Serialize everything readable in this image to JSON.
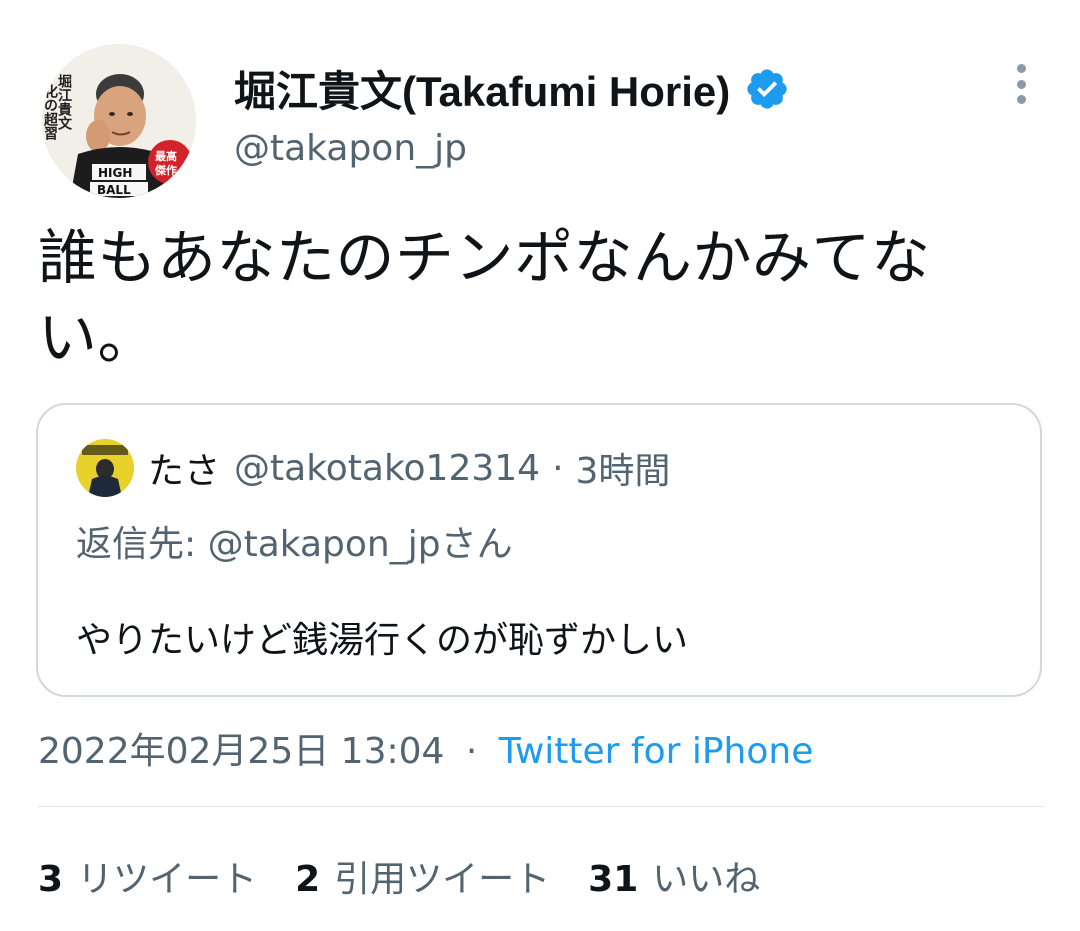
{
  "author": {
    "display_name": "堀江貴文(Takafumi Horie)",
    "handle": "@takapon_jp",
    "verified_icon": "verified-badge-icon",
    "avatar_book_text": [
      "堀江貴文",
      "化の超習",
      "最高傑作",
      "HIGH",
      "BALL"
    ]
  },
  "tweet": {
    "text": "誰もあなたのチンポなんかみてない。"
  },
  "quoted_tweet": {
    "name": "たさ",
    "handle": "@takotako12314",
    "separator": "·",
    "time": "3時間",
    "reply_to": "返信先: @takapon_jpさん",
    "text": "やりたいけど銭湯行くのが恥ずかしい"
  },
  "meta": {
    "timestamp": "2022年02月25日 13:04",
    "separator": "·",
    "source": "Twitter for iPhone"
  },
  "stats": [
    {
      "count": "3",
      "label": "リツイート"
    },
    {
      "count": "2",
      "label": "引用ツイート"
    },
    {
      "count": "31",
      "label": "いいね"
    }
  ],
  "colors": {
    "text_primary": "#0f1419",
    "text_secondary": "#536471",
    "accent": "#1d9bf0",
    "border": "#cfd9de"
  }
}
